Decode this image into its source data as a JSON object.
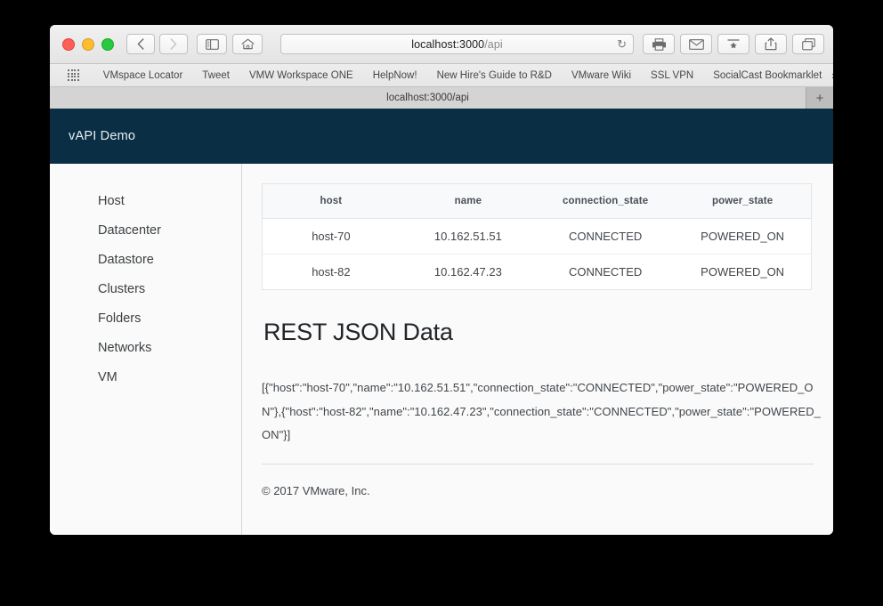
{
  "browser": {
    "window_controls": [
      "close",
      "minimize",
      "zoom"
    ],
    "nav": {
      "back": "back-icon",
      "forward": "forward-icon"
    },
    "sidebar_toggle": "sidebar-icon",
    "home": "home-icon",
    "address": {
      "host": "localhost:3000",
      "path": "/api",
      "full": "localhost:3000/api",
      "reload": "↻"
    },
    "actions": [
      "print-icon",
      "mail-icon",
      "reading-list-icon",
      "share-icon",
      "tabs-icon"
    ],
    "bookmarks": {
      "apps_icon": "apps-grid-icon",
      "items": [
        "VMspace Locator",
        "Tweet",
        "VMW Workspace ONE",
        "HelpNow!",
        "New Hire's Guide to R&D",
        "VMware Wiki",
        "SSL VPN",
        "SocialCast Bookmarklet"
      ],
      "overflow": "»"
    },
    "tabs": [
      {
        "title": "localhost:3000/api"
      }
    ],
    "new_tab_label": "+"
  },
  "page": {
    "brand": "vAPI Demo",
    "navbar_color": "#0a2f45",
    "sidebar": {
      "items": [
        {
          "label": "Host"
        },
        {
          "label": "Datacenter"
        },
        {
          "label": "Datastore"
        },
        {
          "label": "Clusters"
        },
        {
          "label": "Folders"
        },
        {
          "label": "Networks"
        },
        {
          "label": "VM"
        }
      ]
    },
    "table": {
      "headers": [
        "host",
        "name",
        "connection_state",
        "power_state"
      ],
      "rows": [
        [
          "host-70",
          "10.162.51.51",
          "CONNECTED",
          "POWERED_ON"
        ],
        [
          "host-82",
          "10.162.47.23",
          "CONNECTED",
          "POWERED_ON"
        ]
      ]
    },
    "section_title": "REST JSON Data",
    "json_text": "[{\"host\":\"host-70\",\"name\":\"10.162.51.51\",\"connection_state\":\"CONNECTED\",\"power_state\":\"POWERED_ON\"},{\"host\":\"host-82\",\"name\":\"10.162.47.23\",\"connection_state\":\"CONNECTED\",\"power_state\":\"POWERED_ON\"}]",
    "copyright": "© 2017 VMware, Inc."
  }
}
